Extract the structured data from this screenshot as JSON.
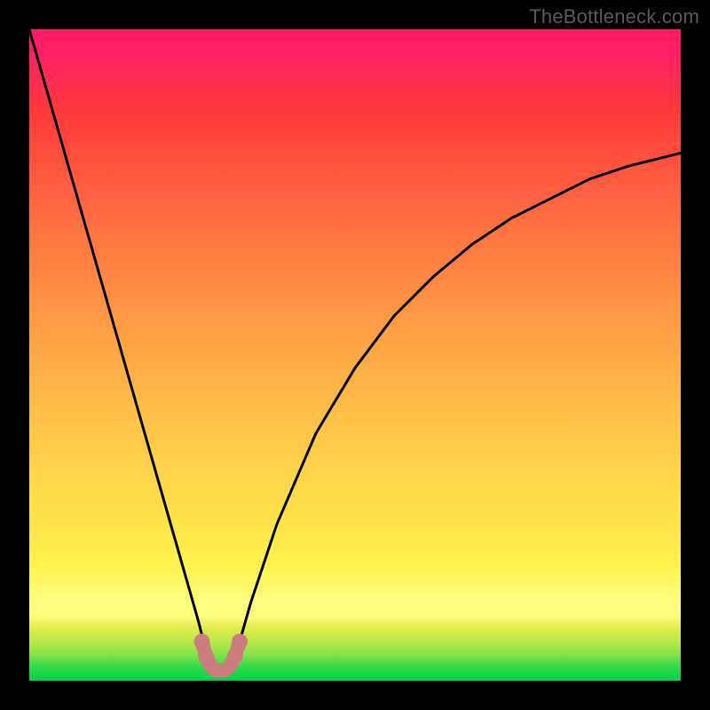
{
  "watermark": "TheBottleneck.com",
  "chart_data": {
    "type": "line",
    "title": "",
    "xlabel": "",
    "ylabel": "",
    "xlim": [
      0,
      100
    ],
    "ylim": [
      0,
      100
    ],
    "grid": false,
    "legend": false,
    "series": [
      {
        "name": "bottleneck-curve",
        "color": "#000000",
        "x": [
          0,
          4,
          8,
          12,
          16,
          20,
          22,
          24,
          26,
          27,
          28,
          29,
          30,
          31,
          32,
          34,
          38,
          44,
          50,
          56,
          62,
          68,
          74,
          80,
          86,
          92,
          100
        ],
        "y": [
          100,
          86,
          72,
          58,
          44,
          30,
          23,
          16,
          9,
          5,
          2.5,
          1.5,
          1.5,
          2.5,
          5,
          12,
          24,
          38,
          48,
          56,
          62,
          67,
          71,
          74,
          77,
          79,
          81
        ]
      },
      {
        "name": "valley-marker",
        "color": "#cc7d7d",
        "x": [
          26.5,
          27.2,
          27.9,
          28.6,
          29.3,
          30.0,
          30.8,
          31.6,
          32.3
        ],
        "y": [
          6.0,
          3.5,
          2.2,
          1.6,
          1.5,
          1.6,
          2.2,
          3.8,
          6.0
        ]
      }
    ]
  }
}
